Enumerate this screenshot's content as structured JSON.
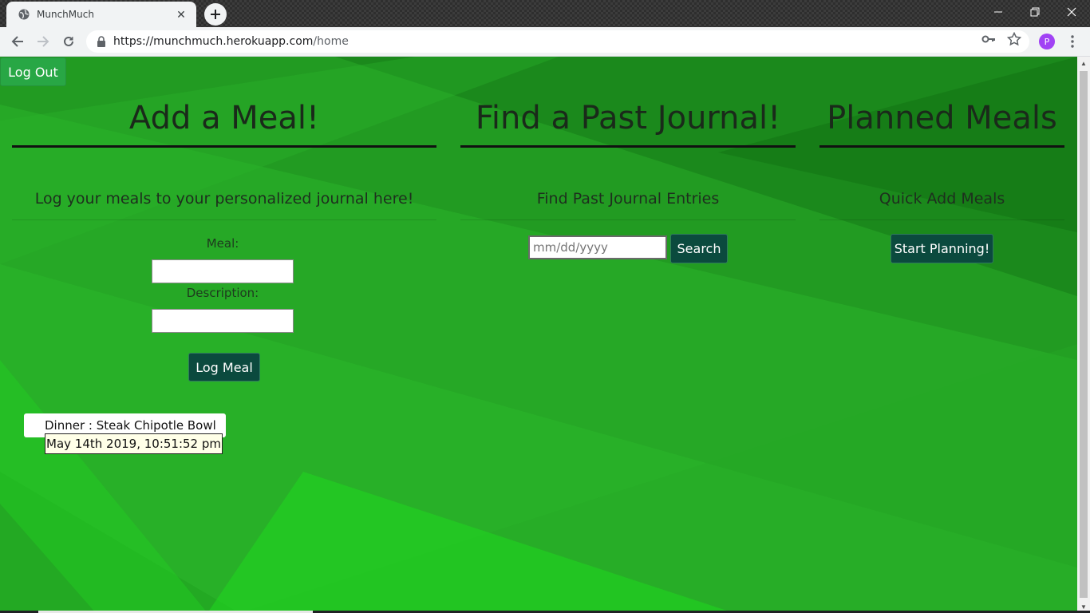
{
  "browser": {
    "tab_title": "MunchMuch",
    "url_host": "https://munchmuch.herokuapp.com",
    "url_path": "/home",
    "profile_initial": "P"
  },
  "page": {
    "logout_label": "Log Out",
    "add_meal": {
      "title": "Add a Meal!",
      "subtitle": "Log your meals to your personalized journal here!",
      "meal_label": "Meal:",
      "meal_value": "",
      "description_label": "Description:",
      "description_value": "",
      "submit_label": "Log Meal"
    },
    "journal": {
      "title": "Find a Past Journal!",
      "subtitle": "Find Past Journal Entries",
      "date_placeholder": "mm/dd/yyyy",
      "search_label": "Search"
    },
    "planned": {
      "title": "Planned Meals",
      "subtitle": "Quick Add Meals",
      "start_label": "Start Planning!"
    },
    "entries": [
      {
        "text": "Dinner : Steak Chipotle Bowl",
        "tooltip": "May 14th 2019, 10:51:52 pm"
      }
    ]
  },
  "colors": {
    "page_green": "#24a224",
    "button_dark_teal": "#0b4a3e",
    "logout_green": "#28a745"
  }
}
